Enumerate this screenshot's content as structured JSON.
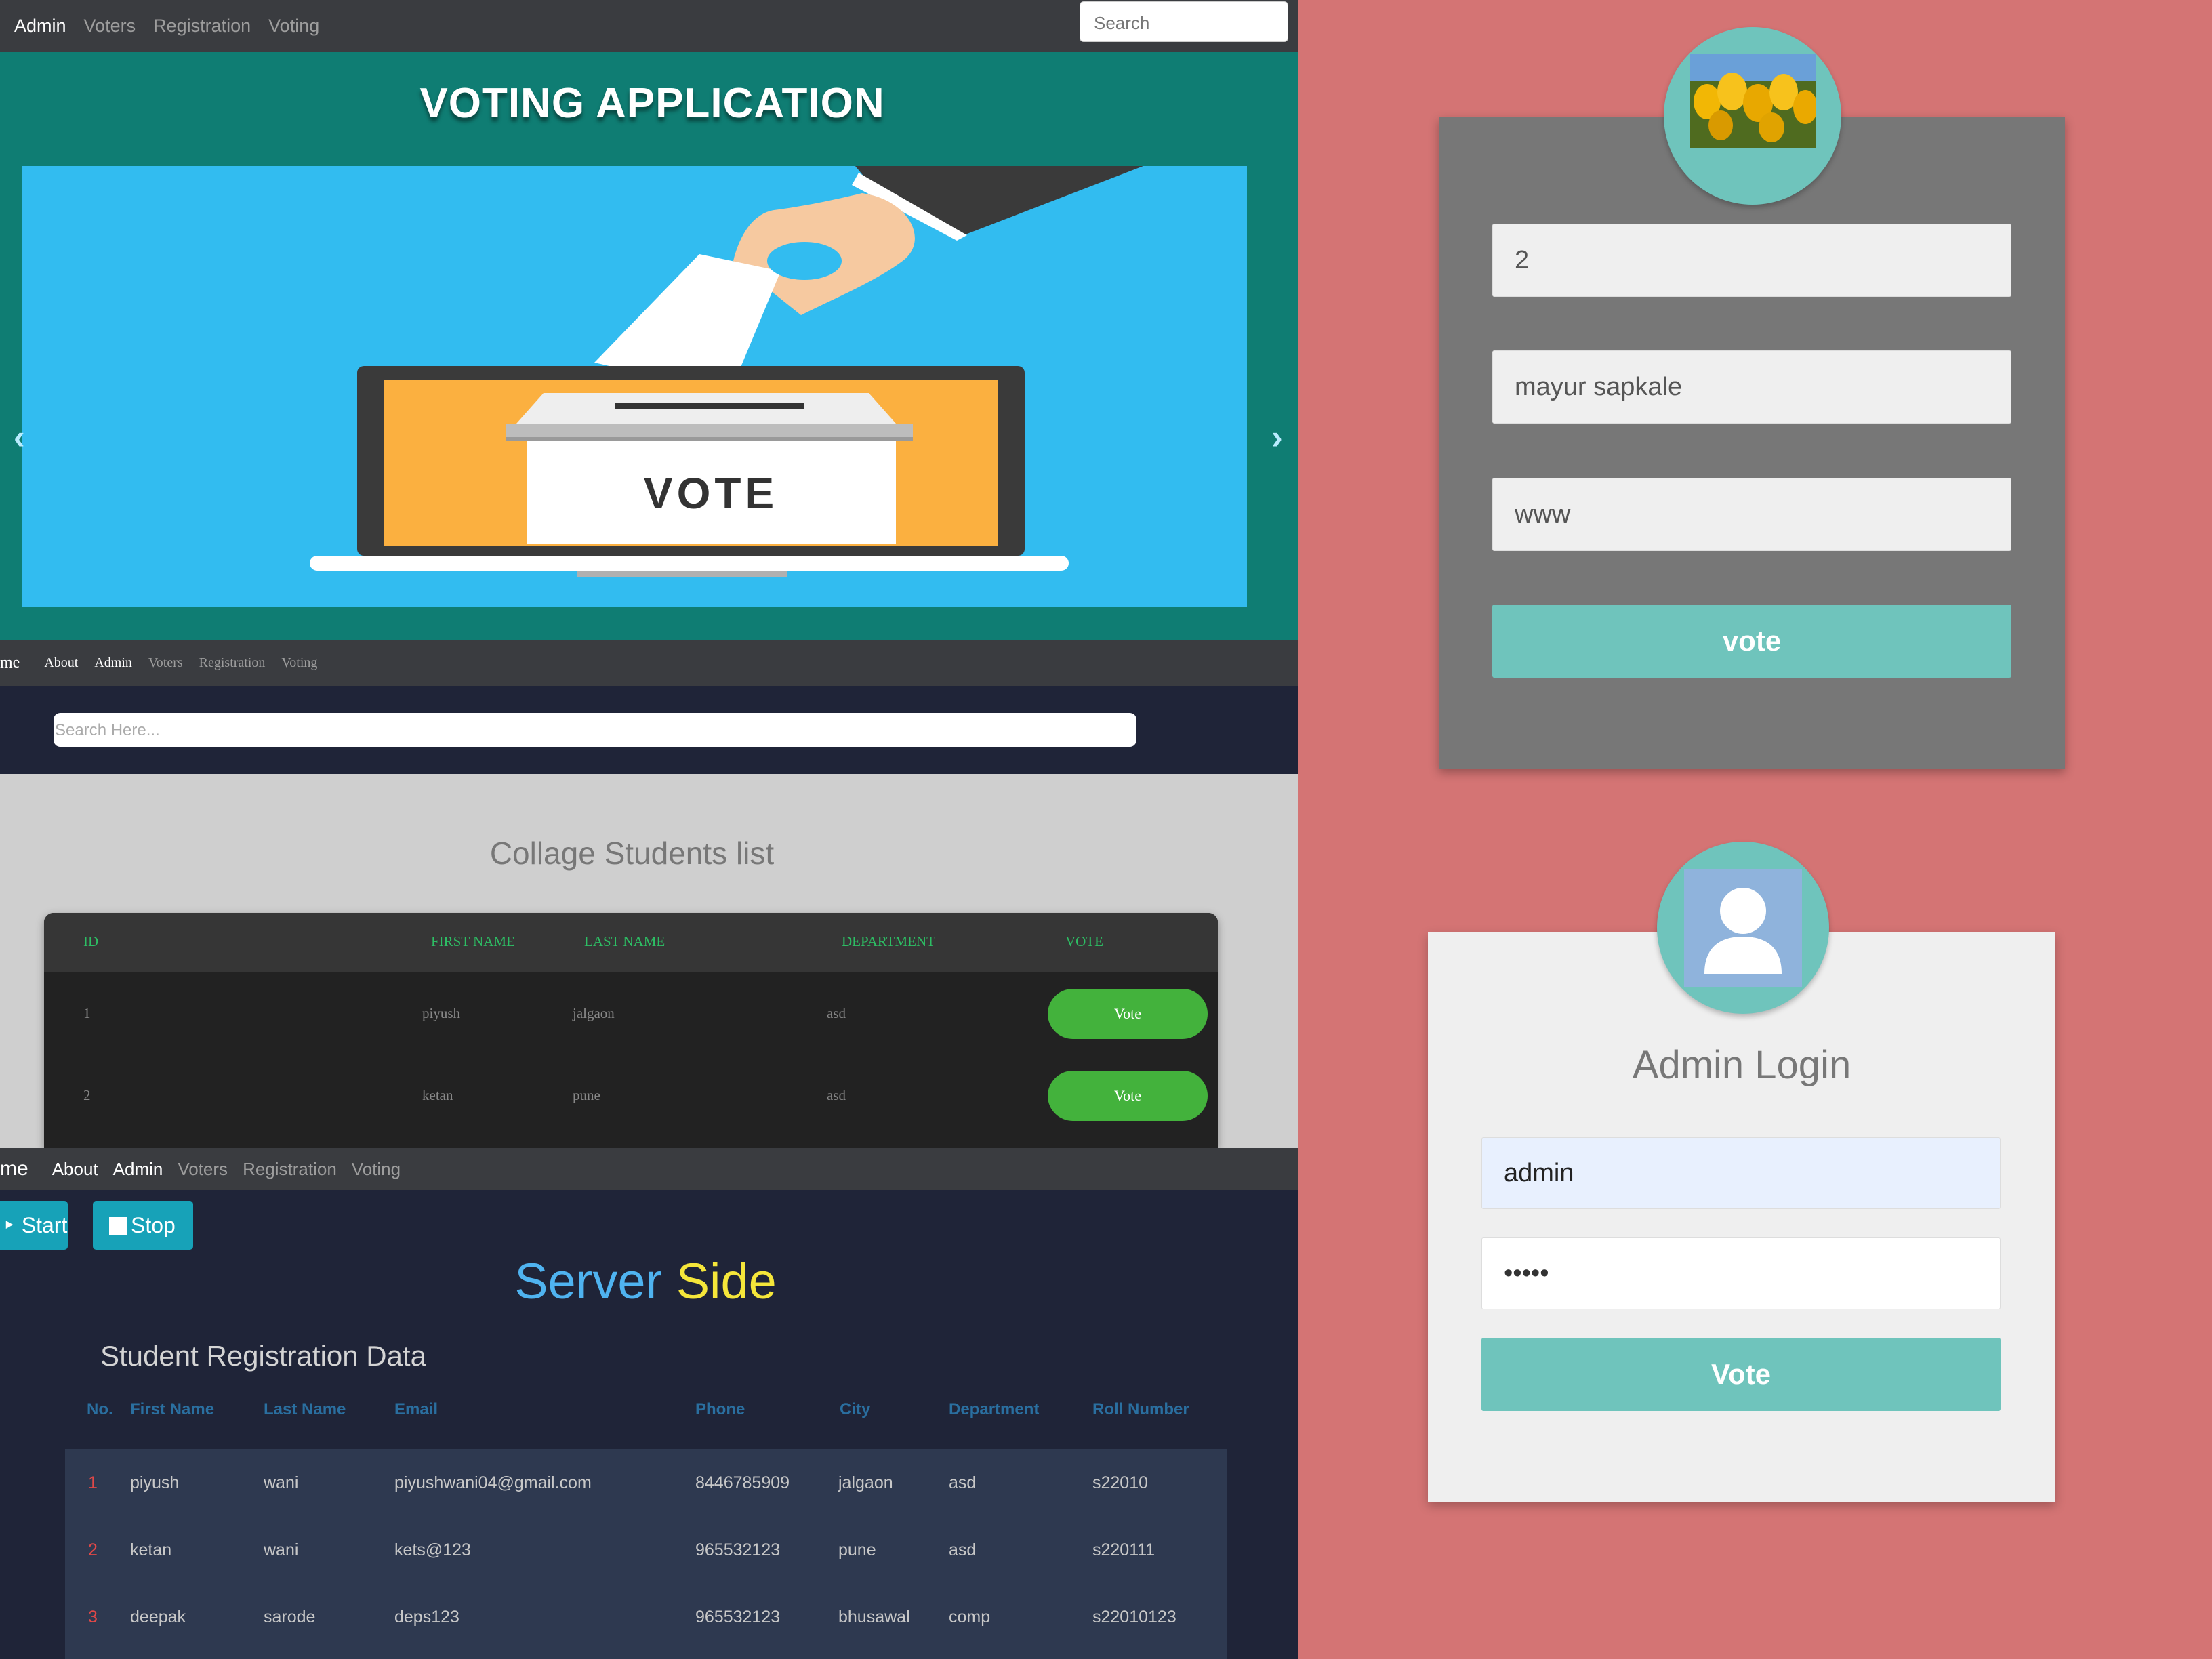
{
  "navbar_top": {
    "items": [
      "Admin",
      "Voters",
      "Registration",
      "Voting"
    ],
    "search_placeholder": "Search"
  },
  "hero": {
    "title": "VOTING APPLICATION",
    "vote_box_label": "VOTE",
    "prev_arrow": "‹",
    "next_arrow": "›"
  },
  "navbar_list": {
    "items": [
      "me",
      "About",
      "Admin",
      "Voters",
      "Registration",
      "Voting"
    ],
    "search_placeholder": "Search Here..."
  },
  "students_list": {
    "title": "Collage Students list",
    "columns": [
      "ID",
      "FIRST NAME",
      "LAST NAME",
      "DEPARTMENT",
      "VOTE"
    ],
    "rows": [
      {
        "id": "1",
        "first": "piyush",
        "last": "jalgaon",
        "dept": "asd",
        "action": "Vote"
      },
      {
        "id": "2",
        "first": "ketan",
        "last": "pune",
        "dept": "asd",
        "action": "Vote"
      }
    ]
  },
  "navbar_server": {
    "items": [
      "me",
      "About",
      "Admin",
      "Voters",
      "Registration",
      "Voting"
    ]
  },
  "server": {
    "start_label": "Start",
    "stop_label": "Stop",
    "title_part1": "Server",
    "title_part2": "Side",
    "colors": {
      "accent_blue": "#4fb3f0",
      "accent_yellow": "#f5e63a"
    },
    "registration_title": "Student Registration Data",
    "columns": [
      "No.",
      "First Name",
      "Last Name",
      "Email",
      "Phone",
      "City",
      "Department",
      "Roll Number"
    ],
    "rows": [
      {
        "no": "1",
        "first": "piyush",
        "last": "wani",
        "email": "piyushwani04@gmail.com",
        "phone": "8446785909",
        "city": "jalgaon",
        "dept": "asd",
        "roll": "s22010"
      },
      {
        "no": "2",
        "first": "ketan",
        "last": "wani",
        "email": "kets@123",
        "phone": "965532123",
        "city": "pune",
        "dept": "asd",
        "roll": "s220111"
      },
      {
        "no": "3",
        "first": "deepak",
        "last": "sarode",
        "email": "deps123",
        "phone": "965532123",
        "city": "bhusawal",
        "dept": "comp",
        "roll": "s22010123"
      }
    ]
  },
  "vote_form": {
    "field1": "2",
    "field2": "mayur sapkale",
    "field3": "www",
    "submit": "vote"
  },
  "admin_login": {
    "title": "Admin Login",
    "username": "admin",
    "password": "•••••",
    "submit": "Vote"
  }
}
